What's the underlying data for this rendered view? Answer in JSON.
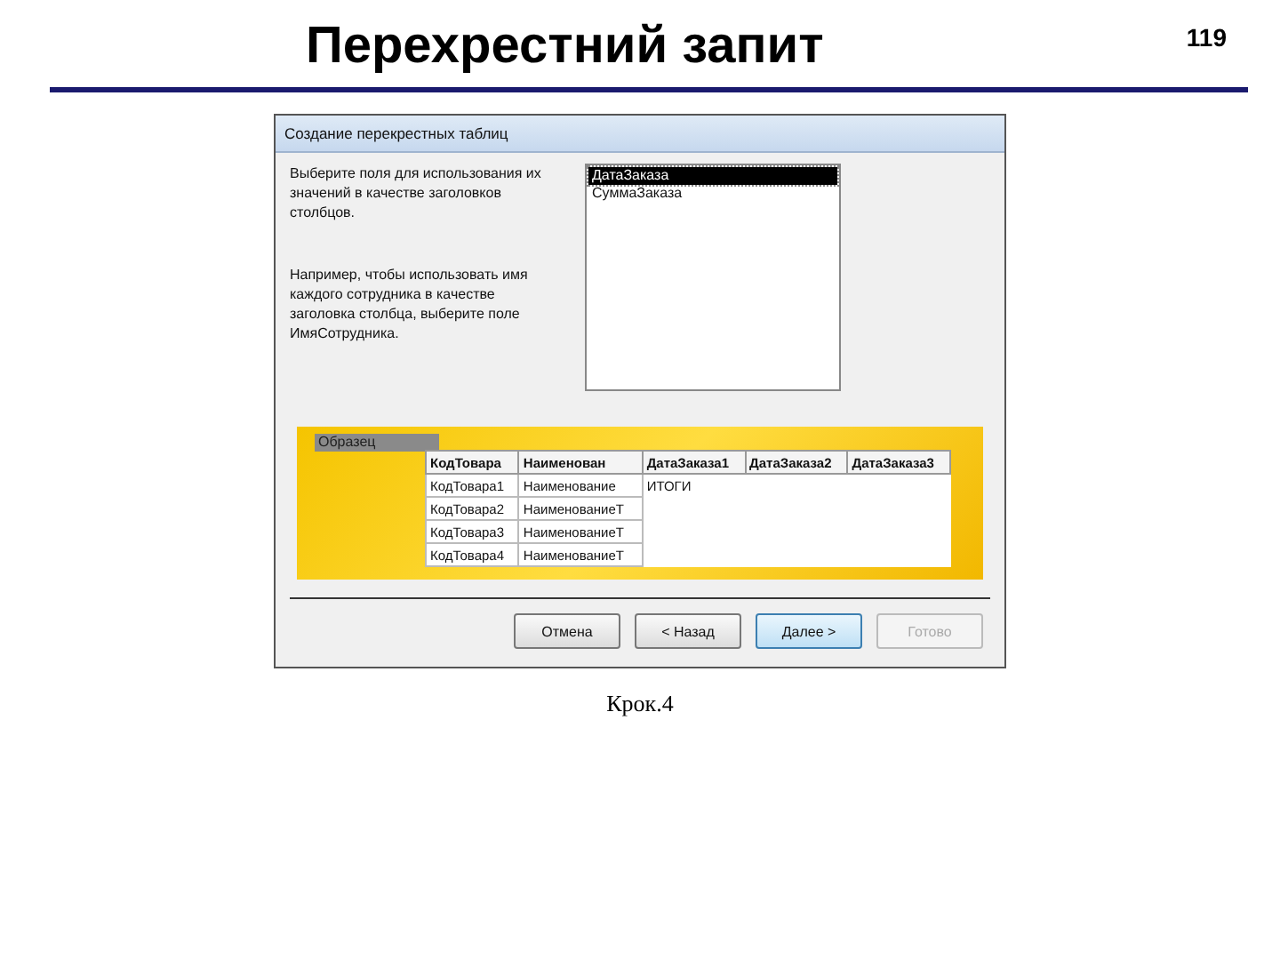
{
  "slide": {
    "title": "Перехрестний запит",
    "page_number": "119",
    "caption": "Крок.4"
  },
  "window": {
    "title": "Создание перекрестных таблиц"
  },
  "instructions": [
    "Выберите поля для использования их значений в качестве заголовков столбцов.",
    "Например, чтобы использовать имя каждого сотрудника в качестве заголовка столбца, выберите поле ИмяСотрудника."
  ],
  "fields": [
    {
      "label": "ДатаЗаказа",
      "selected": true
    },
    {
      "label": "СуммаЗаказа",
      "selected": false
    }
  ],
  "sample": {
    "label": "Образец",
    "columns": [
      "КодТовара",
      "Наименован",
      "ДатаЗаказа1",
      "ДатаЗаказа2",
      "ДатаЗаказа3"
    ],
    "rows": [
      [
        "КодТовара1",
        "Наименование",
        "ИТОГИ"
      ],
      [
        "КодТовара2",
        "НаименованиеТ"
      ],
      [
        "КодТовара3",
        "НаименованиеТ"
      ],
      [
        "КодТовара4",
        "НаименованиеТ"
      ]
    ]
  },
  "buttons": [
    {
      "label": "Отмена",
      "disabled": false,
      "default": false
    },
    {
      "label": "< Назад",
      "disabled": false,
      "default": false
    },
    {
      "label": "Далее >",
      "disabled": false,
      "default": true
    },
    {
      "label": "Готово",
      "disabled": true,
      "default": false
    }
  ]
}
